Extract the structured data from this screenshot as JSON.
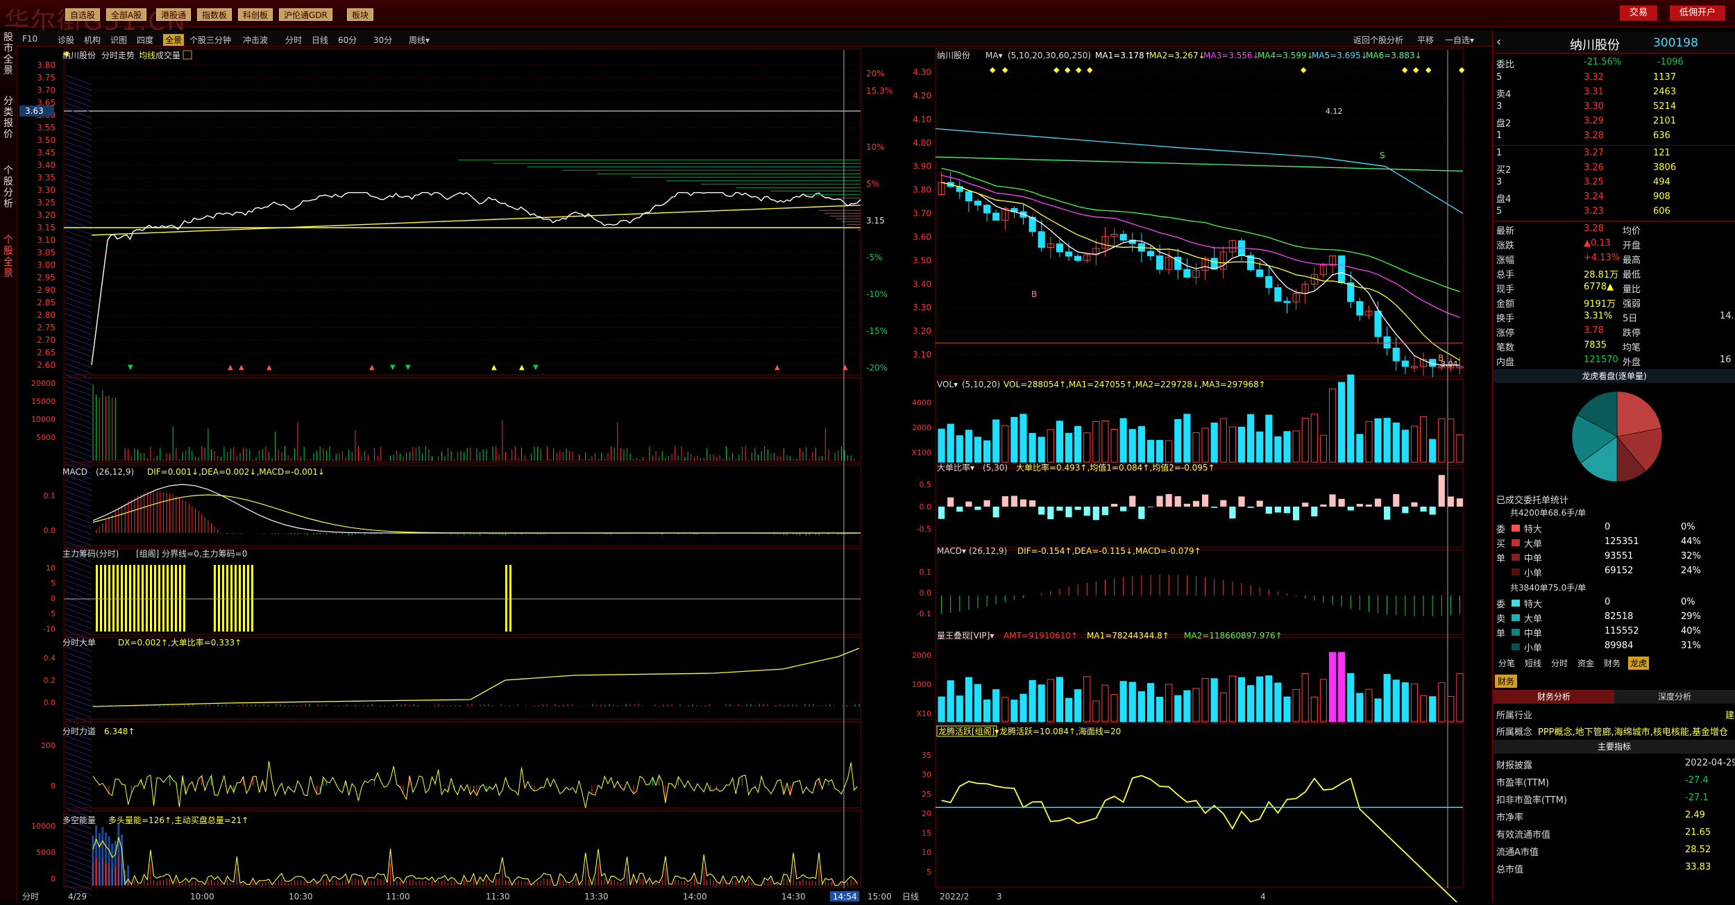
{
  "topbar": {
    "brand": "华尔街G51.CN",
    "menus": [
      "自选股",
      "全部A股",
      "港股通",
      "指数板",
      "科创板",
      "沪伦通GDR",
      "板块"
    ],
    "trade": "交易",
    "open_account": "低佣开户"
  },
  "side_tabs": [
    "股市全景",
    "分类报价",
    "个股分析",
    "个股全景"
  ],
  "toolbar": {
    "items": [
      "F10",
      "诊股",
      "机构",
      "识图",
      "四度",
      "全景",
      "个股三分钟",
      "冲击波",
      "分时",
      "日线",
      "60分",
      "30分",
      "周线▾"
    ],
    "active": "全景",
    "right_items": [
      "返回个股分析",
      "平移",
      "一自选▾"
    ]
  },
  "colors": {
    "up": "#ff3030",
    "down": "#00ffff",
    "grid": "#700000",
    "bg": "#000000",
    "accent": "#ffff30"
  },
  "intraday": {
    "title": "纳川股份",
    "mode": "分时走势",
    "legend": [
      "均线",
      "成交量"
    ],
    "price_ticks": [
      "3.80",
      "3.75",
      "3.70",
      "3.65",
      "3.60",
      "3.55",
      "3.50",
      "3.45",
      "3.40",
      "3.35",
      "3.30",
      "3.25",
      "3.20",
      "3.15",
      "3.10",
      "3.05",
      "3.00",
      "2.95",
      "2.90",
      "2.85",
      "2.80",
      "2.75",
      "2.70",
      "2.65",
      "2.60"
    ],
    "pct_ticks": [
      "20%",
      "15.3%",
      "10%",
      "5%",
      "3.15",
      "-5%",
      "-10%",
      "-15%",
      "-20%"
    ],
    "cursor_price": "3.63",
    "vol_ticks": [
      "20000",
      "15000",
      "10000",
      "5000"
    ],
    "macd_label": "MACD",
    "macd_params": "(26,12,9)",
    "macd_values": "DIF=0.001↓,DEA=0.002↓,MACD=-0.001↓",
    "macd_ticks": [
      "0.1",
      "0.0"
    ],
    "chip_label": "主力筹码(分时)",
    "chip_values": "[组阁] 分界线=0,主力筹码=0",
    "chip_ticks": [
      "10",
      "5",
      "0",
      "-5",
      "-10"
    ],
    "big_label": "分时大单",
    "big_values": "DX=0.002↑,大单比率=0.333↑",
    "big_ticks": [
      "0.4",
      "0.2",
      "0.0"
    ],
    "force_label": "分时力道",
    "force_values": "6.348↑",
    "force_ticks": [
      "200",
      "0"
    ],
    "energy_label": "多空能量",
    "energy_values": "多头量能=126↑,主动买盘总量=21↑",
    "energy_ticks": [
      "10000",
      "5000",
      "0"
    ],
    "time_labels": [
      "分时",
      "4/29",
      "10:00",
      "10:30",
      "11:00",
      "11:30",
      "13:30",
      "14:00",
      "14:30",
      "14:54",
      "15:00"
    ]
  },
  "daily": {
    "title": "纳川股份",
    "ma_label": "MA▾",
    "ma_params": "(5,10,20,30,60,250)",
    "ma_values": [
      "MA1=3.178↑",
      "MA2=3.267↓",
      "MA3=3.556↓",
      "MA4=3.599↓",
      "MA5=3.695↓",
      "MA6=3.883↓"
    ],
    "price_ticks": [
      "4.30",
      "4.20",
      "4.10",
      "4.00",
      "3.90",
      "3.80",
      "3.70",
      "3.60",
      "3.50",
      "3.40",
      "3.30",
      "3.20",
      "3.10"
    ],
    "high_label": "4.12",
    "low_label": "3.04",
    "vol_label": "VOL▾",
    "vol_params": "(5,10,20)",
    "vol_values": "VOL=288054↑,MA1=247055↑,MA2=229728↓,MA3=297968↑",
    "vol_ticks": [
      "4000",
      "2000",
      "X100"
    ],
    "ratio_label": "大单比率▾",
    "ratio_params": "(5,30)",
    "ratio_values": "大单比率=0.493↑,均值1=0.084↑,均值2=-0.095↑",
    "ratio_ticks": [
      "0.5",
      "0.0",
      "-0.5"
    ],
    "macd_label": "MACD▾",
    "macd_params": "(26,12,9)",
    "macd_values": "DIF=-0.154↑,DEA=-0.115↓,MACD=-0.079↑",
    "macd_ticks": [
      "0.1",
      "0.0",
      "-0.1"
    ],
    "amt_label": "量王叠现[VIP]▾",
    "amt_values": [
      "AMT=91910610↑",
      "MA1=78244344.8↑",
      "MA2=118660897.976↑"
    ],
    "amt_ticks": [
      "2000",
      "1000",
      "X10"
    ],
    "dragon_label": "龙腾活跃[组阁]▾",
    "dragon_values": "龙腾活跃=10.084↑,海面线=20",
    "dragon_ticks": [
      "35",
      "30",
      "25",
      "20",
      "15",
      "10",
      "5"
    ],
    "dates": [
      "日线",
      "2022/2",
      "3",
      "4"
    ]
  },
  "quote": {
    "name": "纳川股份",
    "code": "300198",
    "webi_label": "委比",
    "webi_pct": "-21.56%",
    "webi_val": "-1096",
    "sell": [
      {
        "lvl": "5",
        "price": "3.32",
        "vol": "1137"
      },
      {
        "lvl": "4",
        "price": "3.31",
        "vol": "2463"
      },
      {
        "lvl": "3",
        "price": "3.30",
        "vol": "5214"
      },
      {
        "lvl": "2",
        "price": "3.29",
        "vol": "2101"
      },
      {
        "lvl": "1",
        "price": "3.28",
        "vol": "636"
      }
    ],
    "buy": [
      {
        "lvl": "1",
        "price": "3.27",
        "vol": "121"
      },
      {
        "lvl": "2",
        "price": "3.26",
        "vol": "3806"
      },
      {
        "lvl": "3",
        "price": "3.25",
        "vol": "494"
      },
      {
        "lvl": "4",
        "price": "3.24",
        "vol": "908"
      },
      {
        "lvl": "5",
        "price": "3.23",
        "vol": "606"
      }
    ],
    "stats": [
      [
        "最新",
        "3.28",
        "均价",
        ""
      ],
      [
        "涨跌",
        "▲0.13",
        "开盘",
        ""
      ],
      [
        "涨幅",
        "+4.13%",
        "最高",
        ""
      ],
      [
        "总手",
        "28.81万",
        "最低",
        ""
      ],
      [
        "现手",
        "6778▲",
        "量比",
        ""
      ],
      [
        "金额",
        "9191万",
        "强弱",
        ""
      ],
      [
        "换手",
        "3.31%",
        "5日",
        "14."
      ],
      [
        "涨停",
        "3.78",
        "跌停",
        ""
      ],
      [
        "笔数",
        "7835",
        "均笔",
        ""
      ],
      [
        "内盘",
        "121570",
        "外盘",
        "16"
      ]
    ],
    "pie_title": "龙虎看盘(逐单量)",
    "trade_title": "已成交委托单统计",
    "buy_summary": "共4200单68.6手/单",
    "sell_summary": "共3840单75.0手/单",
    "buy_rows": [
      [
        "特大",
        "0",
        "0%"
      ],
      [
        "大单",
        "125351",
        "44%"
      ],
      [
        "中单",
        "93551",
        "32%"
      ],
      [
        "小单",
        "69152",
        "24%"
      ]
    ],
    "sell_rows": [
      [
        "特大",
        "0",
        "0%"
      ],
      [
        "大单",
        "82518",
        "29%"
      ],
      [
        "中单",
        "115552",
        "40%"
      ],
      [
        "小单",
        "89984",
        "31%"
      ]
    ],
    "side_buy": [
      "委",
      "买",
      "单"
    ],
    "side_sell": [
      "委",
      "卖",
      "单"
    ],
    "tabs": [
      "分笔",
      "短线",
      "分时",
      "资金",
      "财务",
      "龙虎"
    ],
    "finance_tab": "财务",
    "finance_sub": [
      "财务分析",
      "深度分析"
    ],
    "industry_label": "所属行业",
    "industry_value": "建",
    "concept_label": "所属概念",
    "concept_value": "PPP概念,地下管廊,海绵城市,核电核能,基金增仓",
    "main_index": "主要指标",
    "fin_rows": [
      [
        "财报披露",
        "2022-04-29"
      ],
      [
        "市盈率(TTM)",
        "-27.4"
      ],
      [
        "扣非市盈率(TTM)",
        "-27.1"
      ],
      [
        "市净率",
        "2.49"
      ],
      [
        "有效流通市值",
        "21.65"
      ],
      [
        "流通A市值",
        "28.52"
      ],
      [
        "总市值",
        "33.83"
      ]
    ]
  }
}
